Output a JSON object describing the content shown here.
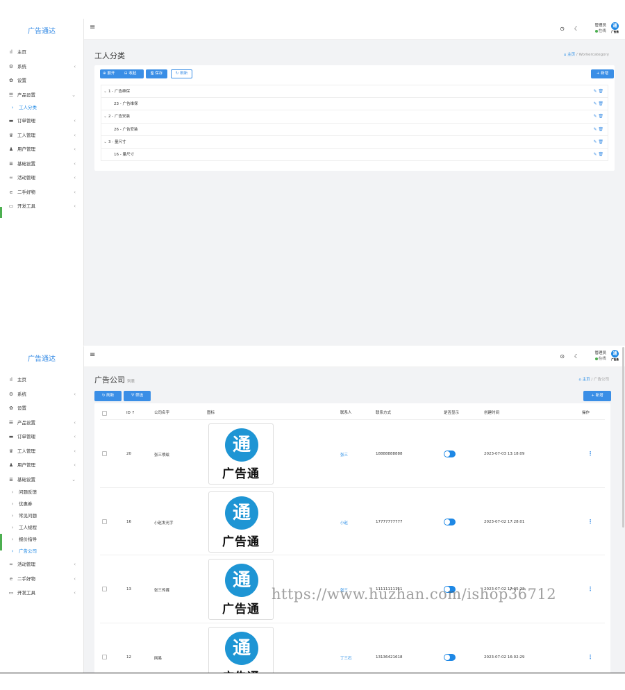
{
  "panel1": {
    "brand": "广告通达",
    "menu": [
      {
        "icon": "ıl",
        "label": "主页",
        "chev": ""
      },
      {
        "icon": "⚙",
        "label": "系统",
        "chev": "‹"
      },
      {
        "icon": "✿",
        "label": "设置",
        "chev": ""
      },
      {
        "icon": "☰",
        "label": "产品设置",
        "chev": "⌄"
      }
    ],
    "submenu": [
      {
        "label": "工人分类",
        "active": true
      }
    ],
    "menu2": [
      {
        "icon": "▬",
        "label": "订单管理",
        "chev": "‹"
      },
      {
        "icon": "♛",
        "label": "工人管理",
        "chev": "‹"
      },
      {
        "icon": "♟",
        "label": "用户管理",
        "chev": "‹"
      },
      {
        "icon": "≣",
        "label": "基础设置",
        "chev": "‹"
      },
      {
        "icon": "∞",
        "label": "活动管理",
        "chev": "‹"
      },
      {
        "icon": "e",
        "label": "二手好物",
        "chev": "‹"
      },
      {
        "icon": "▭",
        "label": "开发工具",
        "chev": "‹"
      }
    ],
    "title": "工人分类",
    "breadcrumb": {
      "home": "主页",
      "sep": "/",
      "current": "Workercategory"
    },
    "buttons": {
      "expand": "⊕ 展开",
      "collapse": "⊟ 收起",
      "save": "🖫 保存",
      "refresh": "↻ 刷新",
      "add": "+ 新增"
    },
    "tree": [
      {
        "id": "1",
        "name": "广告维保",
        "level": 0,
        "toggle": "⌄"
      },
      {
        "id": "23",
        "name": "广告维保",
        "level": 1,
        "toggle": ""
      },
      {
        "id": "2",
        "name": "广告安装",
        "level": 0,
        "toggle": "⌄"
      },
      {
        "id": "26",
        "name": "广告安装",
        "level": 1,
        "toggle": ""
      },
      {
        "id": "3",
        "name": "量尺寸",
        "level": 0,
        "toggle": "⌄"
      },
      {
        "id": "16",
        "name": "量尺寸",
        "level": 1,
        "toggle": ""
      }
    ],
    "row_actions": "✎ 🗑"
  },
  "panel2": {
    "brand": "广告通达",
    "menu": [
      {
        "icon": "ıl",
        "label": "主页",
        "chev": ""
      },
      {
        "icon": "⚙",
        "label": "系统",
        "chev": "‹"
      },
      {
        "icon": "✿",
        "label": "设置",
        "chev": ""
      },
      {
        "icon": "☰",
        "label": "产品设置",
        "chev": "‹"
      },
      {
        "icon": "▬",
        "label": "订单管理",
        "chev": "‹"
      },
      {
        "icon": "♛",
        "label": "工人管理",
        "chev": "‹"
      },
      {
        "icon": "♟",
        "label": "用户管理",
        "chev": "‹"
      },
      {
        "icon": "≣",
        "label": "基础设置",
        "chev": "⌄"
      }
    ],
    "submenu": [
      {
        "label": "问题反馈",
        "active": false
      },
      {
        "label": "优惠券",
        "active": false
      },
      {
        "label": "常见问题",
        "active": false
      },
      {
        "label": "工人规程",
        "active": false
      },
      {
        "label": "报价指导",
        "active": false
      },
      {
        "label": "广告公司",
        "active": true
      }
    ],
    "menu2": [
      {
        "icon": "∞",
        "label": "活动管理",
        "chev": "‹"
      },
      {
        "icon": "e",
        "label": "二手好物",
        "chev": "‹"
      },
      {
        "icon": "▭",
        "label": "开发工具",
        "chev": "‹"
      }
    ],
    "title": "广告公司",
    "subtitle": "列表",
    "breadcrumb": {
      "home": "主页",
      "sep": "/",
      "current": "广告公司"
    },
    "buttons": {
      "refresh": "↻ 刷新",
      "filter": "⛛ 筛选",
      "add": "+ 新增"
    },
    "columns": {
      "id": "ID ↑",
      "name": "公司名字",
      "logo": "图标",
      "contact": "联系人",
      "phone": "联系方式",
      "show": "是否显示",
      "created": "创建时间",
      "ops": "操作"
    },
    "rows": [
      {
        "id": "20",
        "name": "张三喷绘",
        "contact": "张三",
        "phone": "18888888888",
        "created": "2023-07-03 13:18:09"
      },
      {
        "id": "16",
        "name": "小赵发光字",
        "contact": "小赵",
        "phone": "17777777777",
        "created": "2023-07-02 17:28:01"
      },
      {
        "id": "13",
        "name": "张三传媒",
        "contact": "张三",
        "phone": "11111111111",
        "created": "2023-07-02 17:05:22"
      },
      {
        "id": "12",
        "name": "网易",
        "contact": "丁三石",
        "phone": "13136421618",
        "created": "2023-07-02 16:02:29"
      }
    ],
    "logo": {
      "glyph": "通",
      "text": "广告通"
    },
    "row_menu": "⋮"
  },
  "topbar": {
    "menu": "≡",
    "help": "⊙",
    "theme": "☾",
    "user": "管理员",
    "status": "在线",
    "avatar_glyph": "通",
    "avatar_label": "广告通"
  },
  "watermark": "https://www.huzhan.com/ishop36712",
  "colors": {
    "accent": "#1e88e5",
    "brand": "#3a8ee6",
    "online": "#4caf50"
  }
}
